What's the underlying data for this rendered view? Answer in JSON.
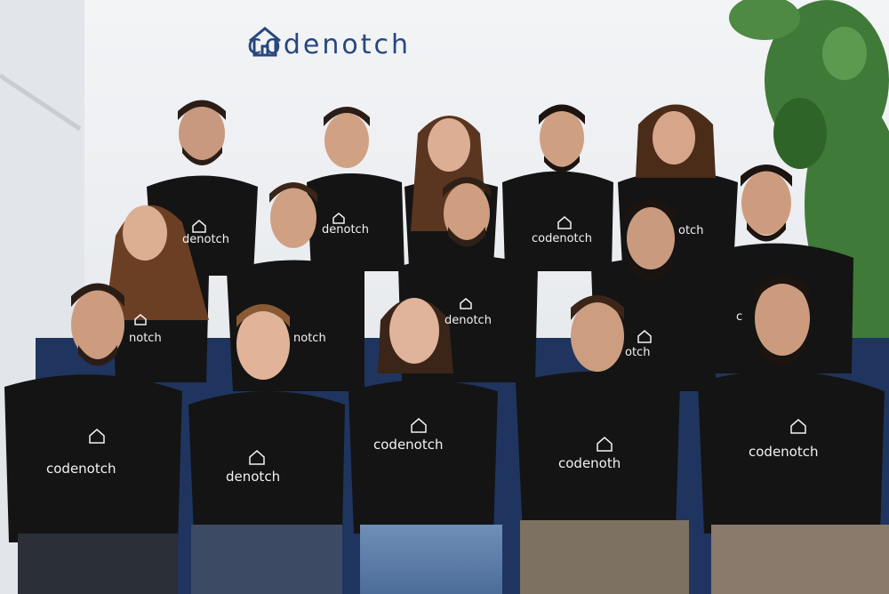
{
  "brand": {
    "wordmark": "codenotch",
    "logo_icon": "house-icon",
    "logo_color": "#27477e"
  },
  "shirts": {
    "full": "codenotch",
    "cropped_a": "denotch",
    "cropped_b": "denotch",
    "cropped_c": "notch",
    "cropped_d": "notch",
    "cropped_e": "otch",
    "cropped_f": "denotch",
    "cropped_g": "otch",
    "cropped_h": "c",
    "full_lower": "codenoth"
  },
  "palette": {
    "wall": "#eef0f2",
    "shirt": "#141414",
    "ivy": "#3f7a38",
    "bench": "#233c7a"
  }
}
